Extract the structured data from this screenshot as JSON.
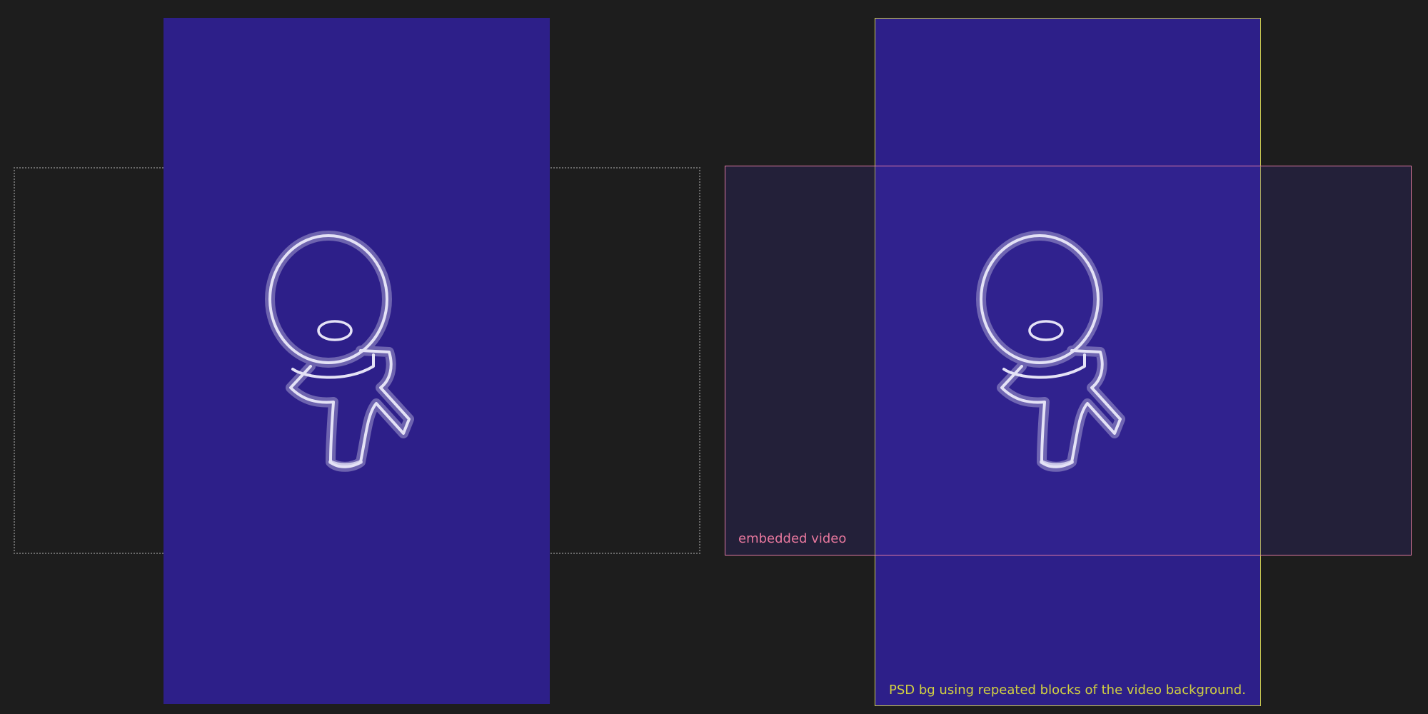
{
  "annotations": {
    "embedded_video_label": "embedded video",
    "psd_bg_label": "PSD bg using repeated blocks of the video background."
  },
  "colors": {
    "canvas": "#1d1d1d",
    "video_background": "#2d1f89",
    "embedded_video_outline": "#e07aa4",
    "psd_bg_outline": "#cfd04a",
    "dotted_outline": "#6a6a6a",
    "sketch_stroke": "#e4e2f6"
  },
  "icons": {
    "character": "chalk-sketch-character-icon"
  }
}
